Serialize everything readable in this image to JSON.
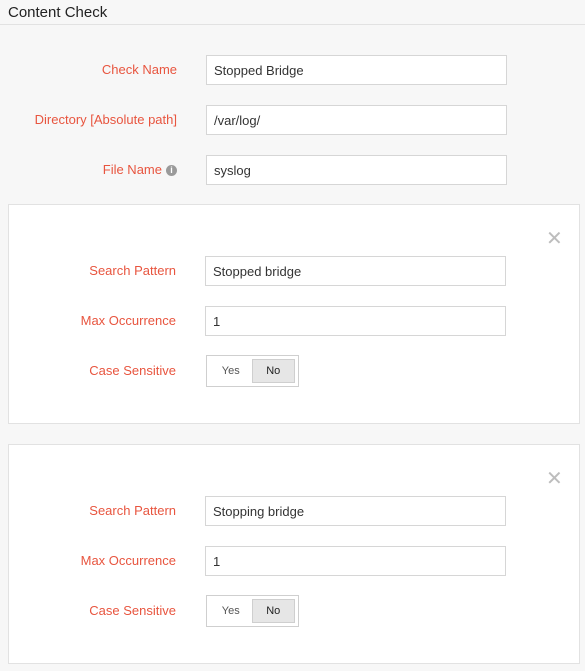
{
  "header": {
    "title": "Content Check"
  },
  "form": {
    "check_name": {
      "label": "Check Name",
      "value": "Stopped Bridge"
    },
    "directory": {
      "label": "Directory [Absolute path]",
      "value": "/var/log/"
    },
    "file_name": {
      "label": "File Name",
      "value": "syslog",
      "info_icon": "i"
    }
  },
  "patterns": [
    {
      "close_icon": "✕",
      "search_pattern_label": "Search Pattern",
      "search_pattern_value": "Stopped bridge",
      "max_occurrence_label": "Max Occurrence",
      "max_occurrence_value": "1",
      "case_sensitive_label": "Case Sensitive",
      "yes_label": "Yes",
      "no_label": "No",
      "selected": "No"
    },
    {
      "close_icon": "✕",
      "search_pattern_label": "Search Pattern",
      "search_pattern_value": "Stopping bridge",
      "max_occurrence_label": "Max Occurrence",
      "max_occurrence_value": "1",
      "case_sensitive_label": "Case Sensitive",
      "yes_label": "Yes",
      "no_label": "No",
      "selected": "No"
    }
  ],
  "colors": {
    "label": "#e8553f",
    "border": "#d6d6d6"
  }
}
